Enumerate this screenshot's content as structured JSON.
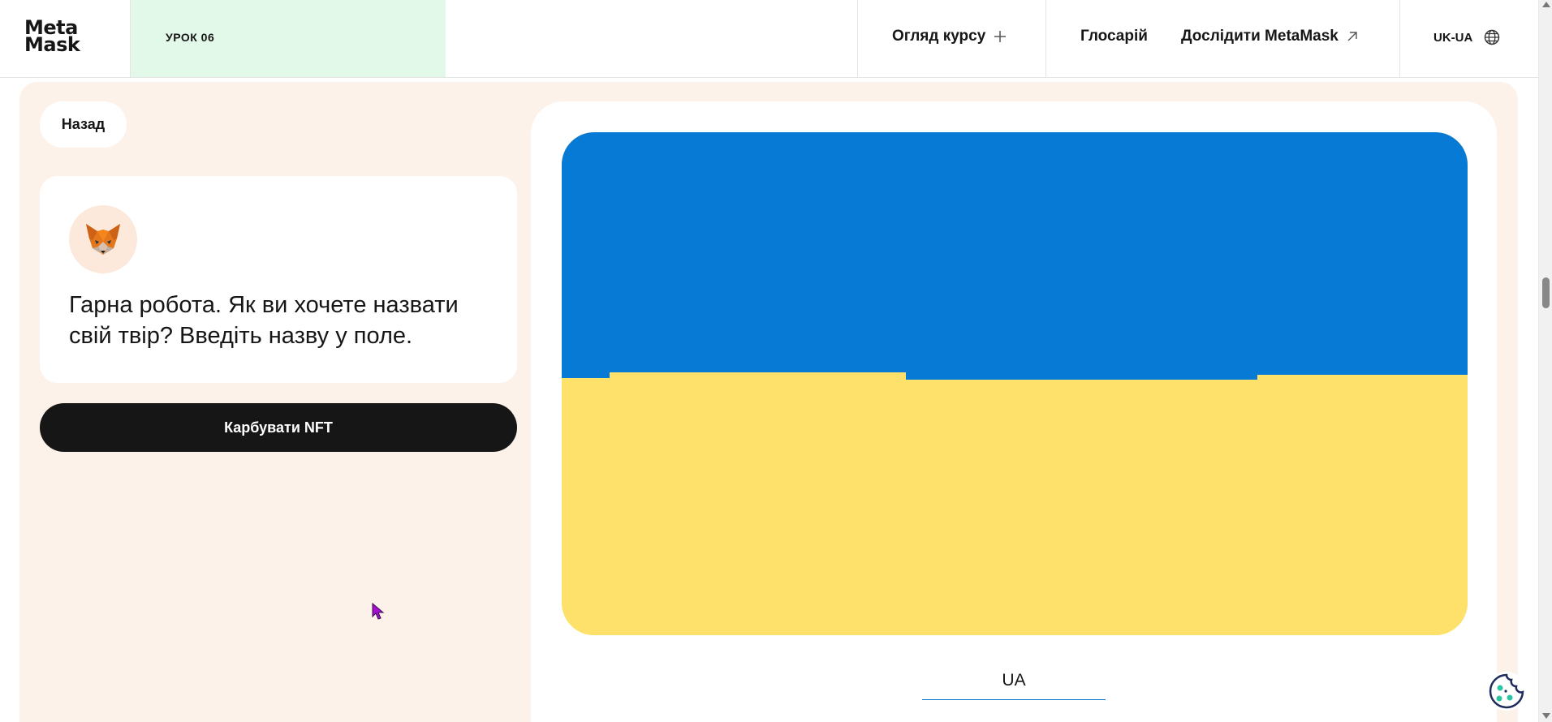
{
  "header": {
    "logo": {
      "line1": "Meta",
      "line2": "Mask"
    },
    "lesson_label": "УРОК 06",
    "nav": {
      "overview_label": "Огляд курсу",
      "glossary_label": "Глосарій",
      "explore_label": "Дослідити MetaMask"
    },
    "language_label": "UK-UA"
  },
  "main": {
    "back_label": "Назад",
    "message": "Гарна робота. Як ви хочете назвати свій твір? Введіть назву у поле.",
    "mint_label": "Карбувати NFT",
    "name_input_value": "UA"
  },
  "colors": {
    "flag_blue": "#067ad4",
    "flag_yellow": "#fde16a",
    "panel_bg": "#fcf2ea",
    "lesson_bg": "#e2f9e9",
    "button_dark": "#161616",
    "input_underline": "#0376c9"
  },
  "icons": {
    "overview": "plus-icon",
    "explore": "arrow-up-right-icon",
    "language": "globe-icon",
    "avatar": "metamask-fox-icon",
    "cookie": "cookie-icon"
  }
}
